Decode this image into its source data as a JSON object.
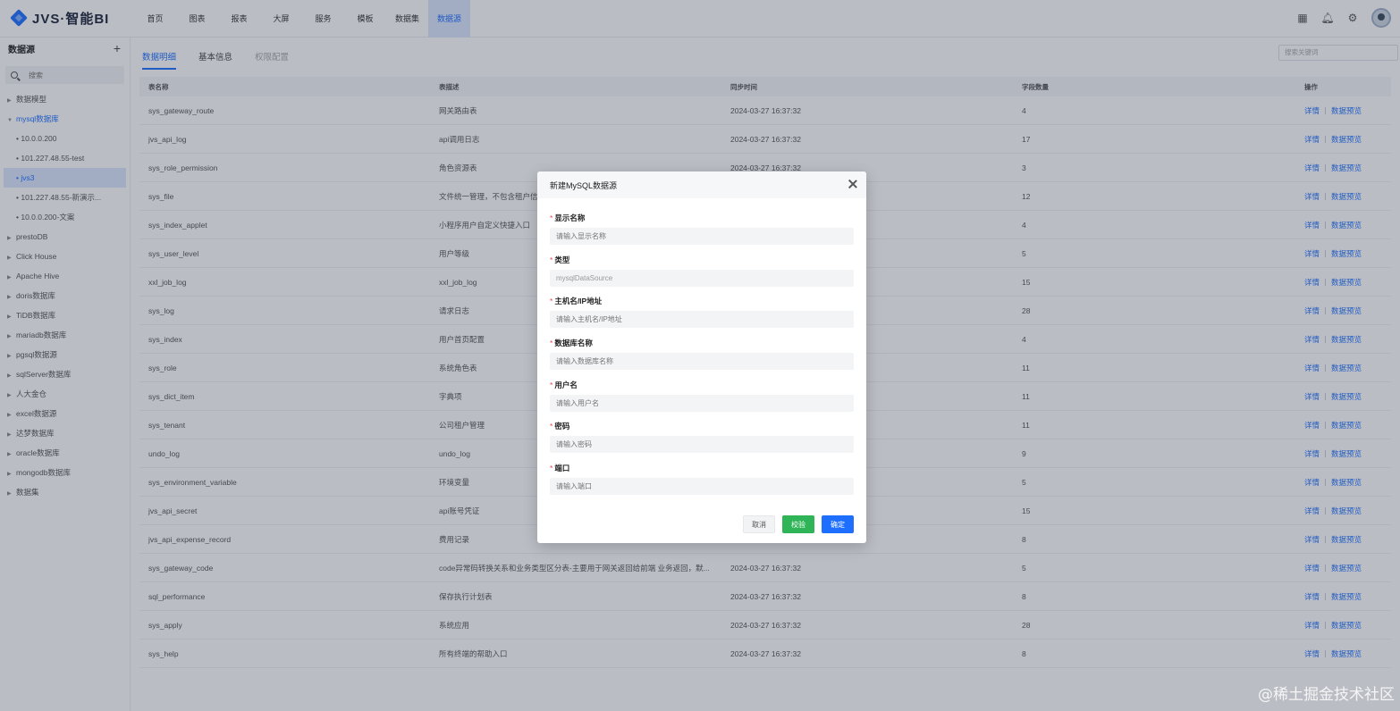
{
  "app": {
    "title": "JVS·智能BI"
  },
  "nav": [
    "首页",
    "图表",
    "报表",
    "大屏",
    "服务",
    "模板",
    "数据集",
    "数据源"
  ],
  "nav_active_index": 7,
  "top_icons": [
    "grid-icon",
    "bell-icon",
    "gear-icon",
    "avatar"
  ],
  "sidebar": {
    "title": "数据源",
    "search_placeholder": "搜索",
    "items": [
      {
        "label": "数据模型",
        "level": 0,
        "state": "collapsed"
      },
      {
        "label": "mysql数据库",
        "level": 0,
        "state": "open"
      },
      {
        "label": "• 10.0.0.200",
        "level": 1
      },
      {
        "label": "• 101.227.48.55-test",
        "level": 1
      },
      {
        "label": "• jvs3",
        "level": 1,
        "selected": true
      },
      {
        "label": "• 101.227.48.55-新演示...",
        "level": 1
      },
      {
        "label": "• 10.0.0.200-文案",
        "level": 1
      },
      {
        "label": "prestoDB",
        "level": 0,
        "state": "collapsed"
      },
      {
        "label": "Click House",
        "level": 0,
        "state": "collapsed"
      },
      {
        "label": "Apache Hive",
        "level": 0,
        "state": "collapsed"
      },
      {
        "label": "doris数据库",
        "level": 0,
        "state": "collapsed"
      },
      {
        "label": "TiDB数据库",
        "level": 0,
        "state": "collapsed"
      },
      {
        "label": "mariadb数据库",
        "level": 0,
        "state": "collapsed"
      },
      {
        "label": "pgsql数据源",
        "level": 0,
        "state": "collapsed"
      },
      {
        "label": "sqlServer数据库",
        "level": 0,
        "state": "collapsed"
      },
      {
        "label": "人大金仓",
        "level": 0,
        "state": "collapsed"
      },
      {
        "label": "excel数据源",
        "level": 0,
        "state": "collapsed"
      },
      {
        "label": "达梦数据库",
        "level": 0,
        "state": "collapsed"
      },
      {
        "label": "oracle数据库",
        "level": 0,
        "state": "collapsed"
      },
      {
        "label": "mongodb数据库",
        "level": 0,
        "state": "collapsed"
      },
      {
        "label": "数据集",
        "level": 0,
        "state": "collapsed"
      }
    ]
  },
  "main": {
    "tabs": [
      "数据明细",
      "基本信息",
      "权限配置"
    ],
    "keyword_placeholder": "搜索关键词",
    "table": {
      "headers": [
        "表名称",
        "表描述",
        "同步时间",
        "字段数量",
        "操作"
      ],
      "action_detail": "详情",
      "action_preview": "数据预览",
      "rows": [
        [
          "sys_gateway_route",
          "网关路由表",
          "2024-03-27 16:37:32",
          "4"
        ],
        [
          "jvs_api_log",
          "api调用日志",
          "2024-03-27 16:37:32",
          "17"
        ],
        [
          "sys_role_permission",
          "角色资源表",
          "2024-03-27 16:37:32",
          "3"
        ],
        [
          "sys_file",
          "文件统一管理，不包含租户信",
          "",
          "12"
        ],
        [
          "sys_index_applet",
          "小程序用户自定义快捷入口",
          "",
          "4"
        ],
        [
          "sys_user_level",
          "用户等级",
          "",
          "5"
        ],
        [
          "xxl_job_log",
          "xxl_job_log",
          "",
          "15"
        ],
        [
          "sys_log",
          "请求日志",
          "",
          "28"
        ],
        [
          "sys_index",
          "用户首页配置",
          "",
          "4"
        ],
        [
          "sys_role",
          "系统角色表",
          "",
          "11"
        ],
        [
          "sys_dict_item",
          "字典项",
          "",
          "11"
        ],
        [
          "sys_tenant",
          "公司租户管理",
          "",
          "11"
        ],
        [
          "undo_log",
          "undo_log",
          "",
          "9"
        ],
        [
          "sys_environment_variable",
          "环境变量",
          "",
          "5"
        ],
        [
          "jvs_api_secret",
          "api账号凭证",
          "",
          "15"
        ],
        [
          "jvs_api_expense_record",
          "费用记录",
          "",
          "8"
        ],
        [
          "sys_gateway_code",
          "code异常码转换关系和业务类型区分表-主要用于网关返回给前端 业务返回，默...",
          "2024-03-27 16:37:32",
          "5"
        ],
        [
          "sql_performance",
          "保存执行计划表",
          "2024-03-27 16:37:32",
          "8"
        ],
        [
          "sys_apply",
          "系统应用",
          "2024-03-27 16:37:32",
          "28"
        ],
        [
          "sys_help",
          "所有终端的帮助入口",
          "2024-03-27 16:37:32",
          "8"
        ]
      ]
    }
  },
  "modal": {
    "title": "新建MySQL数据源",
    "fields": [
      {
        "label": "显示名称",
        "placeholder": "请输入显示名称",
        "value": ""
      },
      {
        "label": "类型",
        "placeholder": "",
        "value": "mysqlDataSource"
      },
      {
        "label": "主机名/IP地址",
        "placeholder": "请输入主机名/IP地址",
        "value": ""
      },
      {
        "label": "数据库名称",
        "placeholder": "请输入数据库名称",
        "value": ""
      },
      {
        "label": "用户名",
        "placeholder": "请输入用户名",
        "value": ""
      },
      {
        "label": "密码",
        "placeholder": "请输入密码",
        "value": ""
      },
      {
        "label": "端口",
        "placeholder": "请输入端口",
        "value": ""
      }
    ],
    "buttons": {
      "cancel": "取消",
      "validate": "校验",
      "ok": "确定"
    }
  },
  "watermark": "@稀土掘金技术社区",
  "colors": {
    "accent": "#1e6fff",
    "validate": "#2fb457",
    "required": "#f04848"
  }
}
